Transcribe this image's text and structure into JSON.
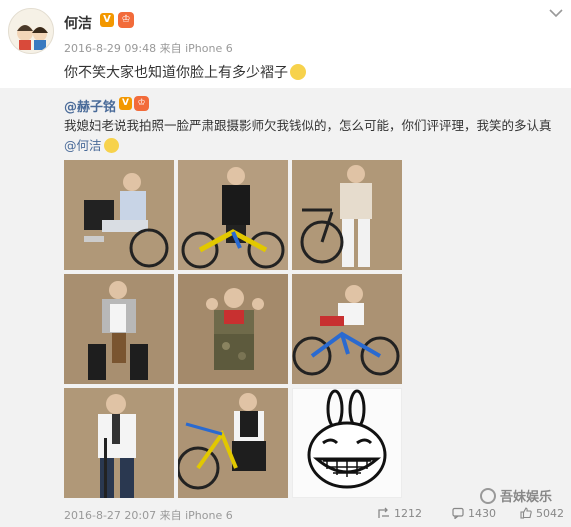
{
  "post": {
    "username": "何洁",
    "verified_badge": "V",
    "level_badge": "♔",
    "meta": "2016-8-29 09:48 来自 iPhone 6",
    "text": "你不笑大家也知道你脸上有多少褶子",
    "text_emoji": "grin-sweat-emoji",
    "more_icon": "chevron-down-icon"
  },
  "repost": {
    "username": "@赫子铭",
    "verified_badge": "V",
    "level_badge": "♔",
    "text": "我媳妇老说我拍照一脸严肃跟摄影师欠我钱似的，怎么可能，你们评评理，我笑的多认真",
    "mention": "@何洁",
    "text_emoji": "smile-emoji",
    "photos": [
      {
        "name": "photo-1",
        "subject": "man-seated-white-shirt"
      },
      {
        "name": "photo-2",
        "subject": "man-leather-jacket-bike"
      },
      {
        "name": "photo-3",
        "subject": "man-sweater-bike"
      },
      {
        "name": "photo-4",
        "subject": "man-seated-stool"
      },
      {
        "name": "photo-5",
        "subject": "man-camo-jacket"
      },
      {
        "name": "photo-6",
        "subject": "man-riding-bike"
      },
      {
        "name": "photo-7",
        "subject": "man-white-shirt-standing"
      },
      {
        "name": "photo-8",
        "subject": "man-crouching-bike"
      },
      {
        "name": "photo-9",
        "subject": "grinning-rabbit-sticker"
      }
    ],
    "meta": "2016-8-27 20:07 来自 iPhone 6",
    "reposts": "1212",
    "comments": "1430",
    "likes": "5042"
  },
  "watermark": "吾妹娱乐",
  "colors": {
    "link": "#4a6b99",
    "verified": "#f39800",
    "repost_bg": "#f2f2f2",
    "photo_bg": "#a68d6f"
  }
}
